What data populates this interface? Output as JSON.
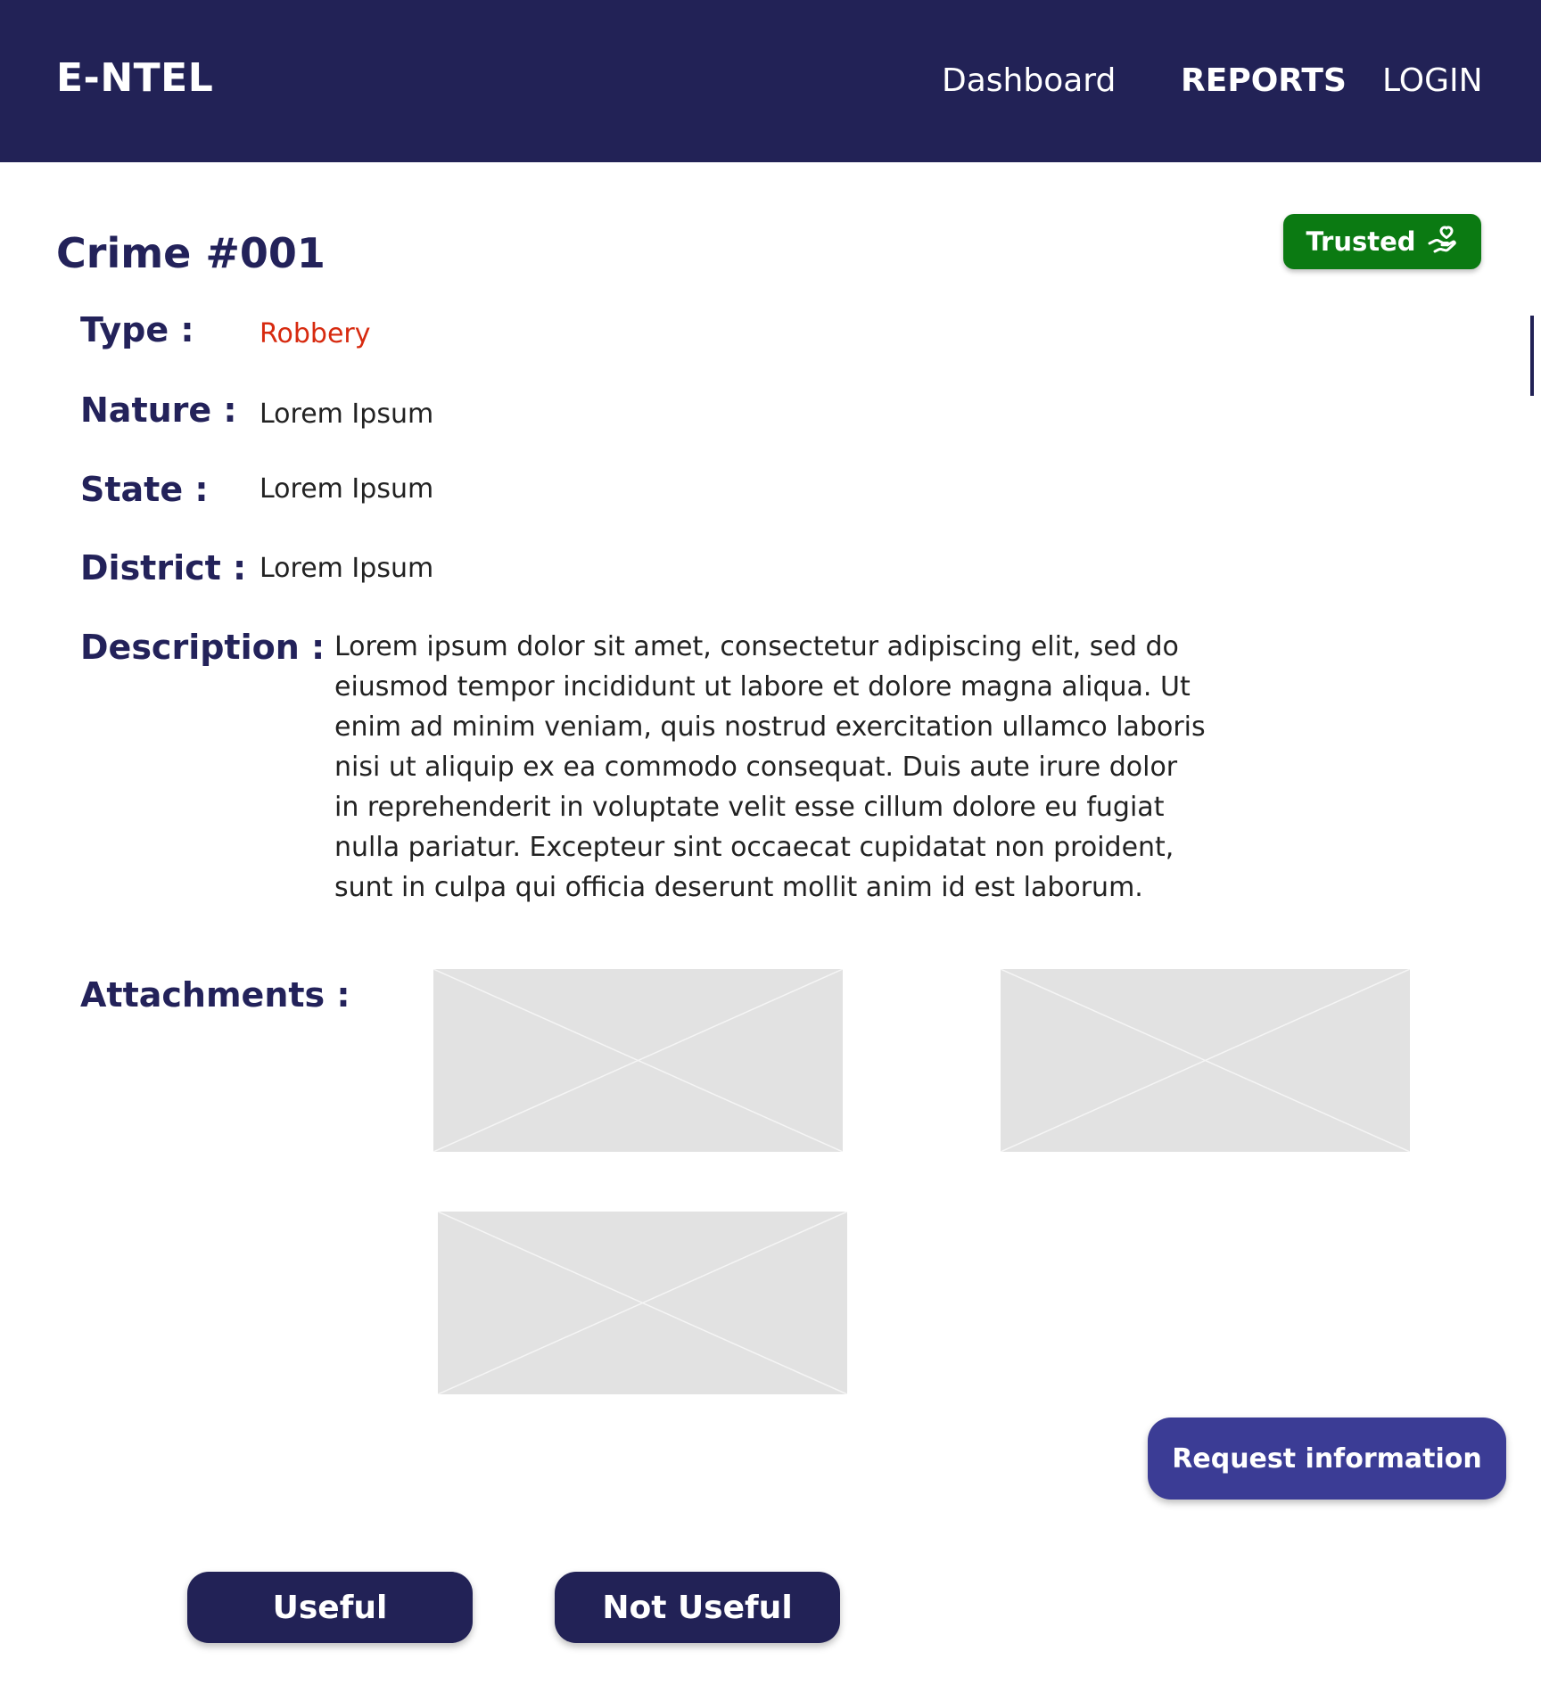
{
  "header": {
    "logo": "E-NTEL",
    "nav": [
      {
        "label": "Dashboard"
      },
      {
        "label": "REPORTS"
      },
      {
        "label": "LOGIN"
      }
    ]
  },
  "report": {
    "title": "Crime #001",
    "badge": {
      "label": "Trusted",
      "icon": "hand-heart-icon",
      "color": "#0b7a12"
    },
    "fields": {
      "type": {
        "label": "Type :",
        "value": "Robbery",
        "value_color": "#d72a0f"
      },
      "nature": {
        "label": "Nature :",
        "value": "Lorem Ipsum"
      },
      "state": {
        "label": "State :",
        "value": "Lorem Ipsum"
      },
      "district": {
        "label": "District :",
        "value": "Lorem Ipsum"
      }
    },
    "description": {
      "label": "Description :",
      "text": "Lorem ipsum dolor sit amet, consectetur adipiscing elit, sed do eiusmod tempor incididunt ut labore et dolore magna aliqua. Ut enim ad minim veniam, quis nostrud exercitation ullamco laboris nisi ut aliquip ex ea commodo consequat. Duis aute irure dolor in reprehenderit in voluptate velit esse cillum dolore eu fugiat nulla pariatur. Excepteur sint occaecat cupidatat non proident, sunt in culpa qui officia deserunt mollit anim id est laborum."
    },
    "attachments": {
      "label": "Attachments :",
      "count": 3
    }
  },
  "actions": {
    "request_info": "Request information",
    "useful": "Useful",
    "not_useful": "Not Useful"
  },
  "colors": {
    "primary": "#222256",
    "accent_button": "#3b3c95",
    "trusted": "#0b7a12",
    "type_value": "#d72a0f"
  }
}
